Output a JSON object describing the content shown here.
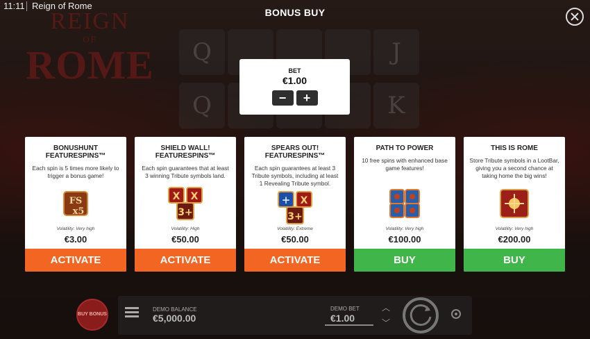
{
  "status_bar": {
    "time": "11:11",
    "game_name": "Reign of Rome"
  },
  "title": "BONUS BUY",
  "logo": {
    "line1": "REIGN",
    "line2": "OF",
    "line3": "ROME"
  },
  "reels": [
    "Q",
    "",
    "",
    "",
    "J",
    "Q",
    "",
    "",
    "",
    "K"
  ],
  "bet": {
    "label": "BET",
    "value": "€1.00",
    "minus": "−",
    "plus": "+"
  },
  "cards": [
    {
      "title": "BONUSHUNT FEATURESPINS™",
      "desc": "Each spin is 5 times more likely to trigger a bonus game!",
      "icon": "fs-x5-icon",
      "volatility": "Volatility: Very high",
      "price": "€3.00",
      "button": "ACTIVATE",
      "button_color": "#f26522"
    },
    {
      "title": "SHIELD WALL! FEATURESPINS™",
      "desc": "Each spin guarantees that at least 3 winning Tribute symbols land.",
      "icon": "shield-3plus-icon",
      "volatility": "Volatility: High",
      "price": "€50.00",
      "button": "ACTIVATE",
      "button_color": "#f26522"
    },
    {
      "title": "SPEARS OUT! FEATURESPINS™",
      "desc": "Each spin guarantees at least 3 Tribute symbols, including at least 1 Revealing Tribute symbol.",
      "icon": "spears-3plus-icon",
      "volatility": "Volatility: Extreme",
      "price": "€50.00",
      "button": "ACTIVATE",
      "button_color": "#f26522"
    },
    {
      "title": "PATH TO POWER",
      "desc": "10 free spins with enhanced base game features!",
      "icon": "shields-blue-icon",
      "volatility": "Volatility: Very high",
      "price": "€100.00",
      "button": "BUY",
      "button_color": "#40b549"
    },
    {
      "title": "THIS IS ROME",
      "desc": "Store Tribute symbols in a LootBar, giving you a second chance at taking home the big wins!",
      "icon": "lootbar-shield-icon",
      "volatility": "Volatility: Very high",
      "price": "€200.00",
      "button": "BUY",
      "button_color": "#40b549"
    }
  ],
  "bottom_bar": {
    "buy_bonus": "BUY BONUS",
    "balance_label": "DEMO BALANCE",
    "balance_value": "€5,000.00",
    "bet_label": "DEMO BET",
    "bet_value": "€1.00"
  }
}
